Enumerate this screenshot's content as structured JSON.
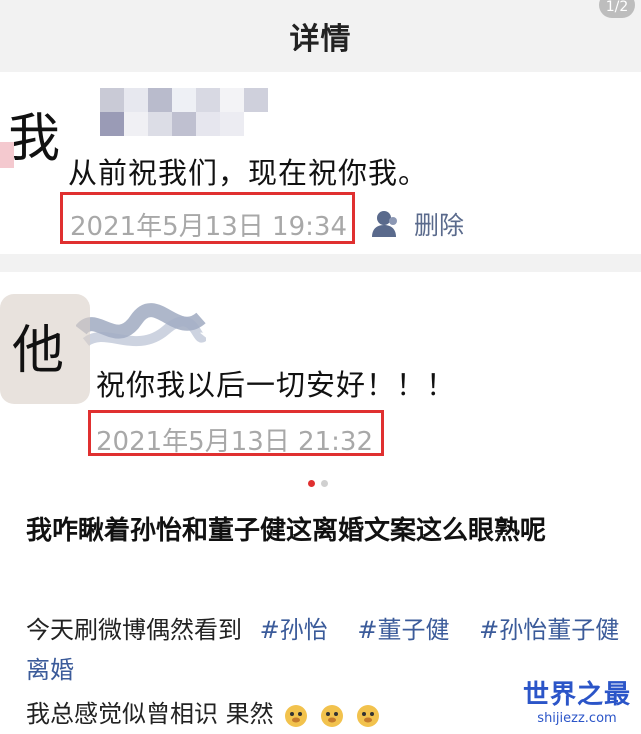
{
  "header": {
    "title": "详情",
    "page_indicator": "1/2"
  },
  "first_comment": {
    "name_overlay": "我",
    "message": "从前祝我们，现在祝你我。",
    "timestamp": "2021年5月13日 19:34",
    "delete_label": "删除",
    "icon": "person-icon"
  },
  "second_comment": {
    "name_overlay": "他",
    "message": "祝你我以后一切安好！！！",
    "timestamp": "2021年5月13日 21:32"
  },
  "carousel": {
    "total": 2,
    "active": 1
  },
  "article": {
    "title": "我咋瞅着孙怡和董子健这离婚文案这么眼熟呢",
    "line1_prefix": "今天刷微博偶然看到",
    "tags": [
      "#孙怡",
      "#董子健",
      "#孙怡董子健离婚"
    ],
    "line2": "我总感觉似曾相识 果然"
  },
  "watermark": {
    "title": "世界之最",
    "subtitle": "shijiezz.com"
  },
  "colors": {
    "highlight_box": "#e03030",
    "link": "#3b5b9a",
    "timestamp": "#a8a8a8"
  }
}
